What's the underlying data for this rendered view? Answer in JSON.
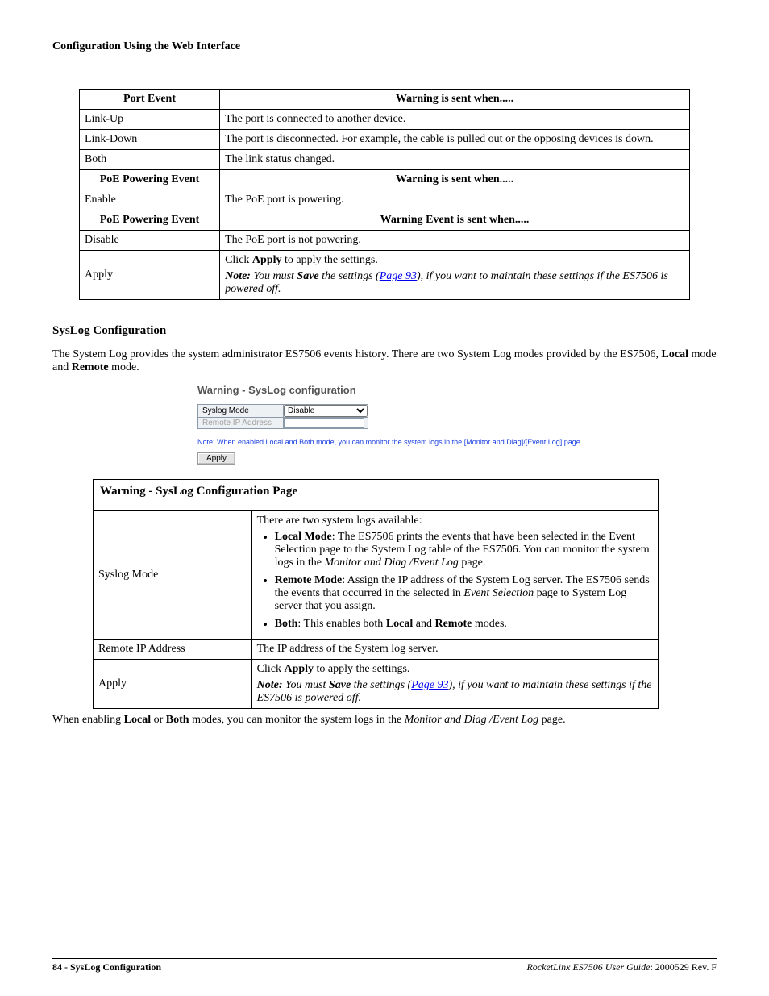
{
  "header": "Configuration Using the Web Interface",
  "table1": {
    "rows": [
      {
        "h1": "Port Event",
        "h2": "Warning is sent when.....",
        "isHeader": true
      },
      {
        "c1": "Link-Up",
        "c2": "The port is connected to another device."
      },
      {
        "c1": "Link-Down",
        "c2": "The port is disconnected. For example, the cable is pulled out or the opposing devices is down."
      },
      {
        "c1": "Both",
        "c2": "The link status changed."
      },
      {
        "h1": "PoE Powering Event",
        "h2": "Warning is sent when.....",
        "isHeader": true
      },
      {
        "c1": "Enable",
        "c2": "The PoE port is powering."
      },
      {
        "h1": "PoE Powering Event",
        "h2": "Warning Event is sent when.....",
        "isHeader": true
      },
      {
        "c1": "Disable",
        "c2": "The PoE port is not powering."
      }
    ],
    "apply_label": "Apply",
    "apply_click_pre": "Click ",
    "apply_click_bold": "Apply",
    "apply_click_post": " to apply the settings.",
    "apply_note_pre": "Note:",
    "apply_note_mid1": " You must ",
    "apply_note_save": "Save",
    "apply_note_mid2": " the settings (",
    "apply_note_link": "Page 93",
    "apply_note_end": "), if you want to maintain these settings if the ES7506 is powered off."
  },
  "section_title": "SysLog Configuration",
  "intro_pre": "The System Log provides the system administrator ES7506 events history. There are two System Log modes provided by the ES7506, ",
  "intro_local": "Local",
  "intro_mid": " mode and ",
  "intro_remote": "Remote",
  "intro_end": " mode.",
  "ui": {
    "title": "Warning - SysLog configuration",
    "syslog_mode_label": "Syslog Mode",
    "syslog_mode_value": "Disable",
    "remote_ip_label": "Remote IP Address",
    "note": "Note: When enabled Local and Both mode, you can monitor the system logs in the [Monitor and Diag]/[Event Log] page.",
    "apply": "Apply"
  },
  "table2": {
    "title": "Warning - SysLog Configuration Page",
    "row1_label": "Syslog Mode",
    "row1_intro": "There are two system logs available:",
    "row1_b1_bold": "Local Mode",
    "row1_b1_text": ": The ES7506 prints the events that have been selected in the Event Selection page to the System Log table of the ES7506. You can monitor the system logs in the ",
    "row1_b1_ital": "Monitor and Diag /Event Log",
    "row1_b1_end": " page.",
    "row1_b2_bold": "Remote Mode",
    "row1_b2_text": ": Assign the IP address of the System Log server. The ES7506 sends the events that occurred in the selected in ",
    "row1_b2_ital": "Event Selection",
    "row1_b2_end": " page to System Log server that you assign.",
    "row1_b3_bold": "Both",
    "row1_b3_text": ": This enables both ",
    "row1_b3_local": "Local",
    "row1_b3_and": " and ",
    "row1_b3_remote": "Remote",
    "row1_b3_end": " modes.",
    "row2_label": "Remote IP Address",
    "row2_text": "The IP address of the System log server.",
    "row3_label": "Apply",
    "row3_click_pre": "Click ",
    "row3_click_bold": "Apply",
    "row3_click_post": " to apply the settings.",
    "row3_note_pre": "Note:",
    "row3_note_mid1": " You must ",
    "row3_note_save": "Save",
    "row3_note_mid2": " the settings (",
    "row3_note_link": "Page 93",
    "row3_note_end": "), if you want to maintain these settings if the ES7506 is powered off."
  },
  "closing_pre": "When enabling ",
  "closing_local": "Local",
  "closing_or": " or ",
  "closing_both": "Both",
  "closing_mid": " modes, you can monitor the system logs in the ",
  "closing_ital": "Monitor and Diag /Event Log",
  "closing_end": " page.",
  "footer_left_pre": "84 - ",
  "footer_left_bold": "SysLog Configuration",
  "footer_right_ital": "RocketLinx ES7506  User Guide",
  "footer_right_rest": ": 2000529 Rev. F"
}
